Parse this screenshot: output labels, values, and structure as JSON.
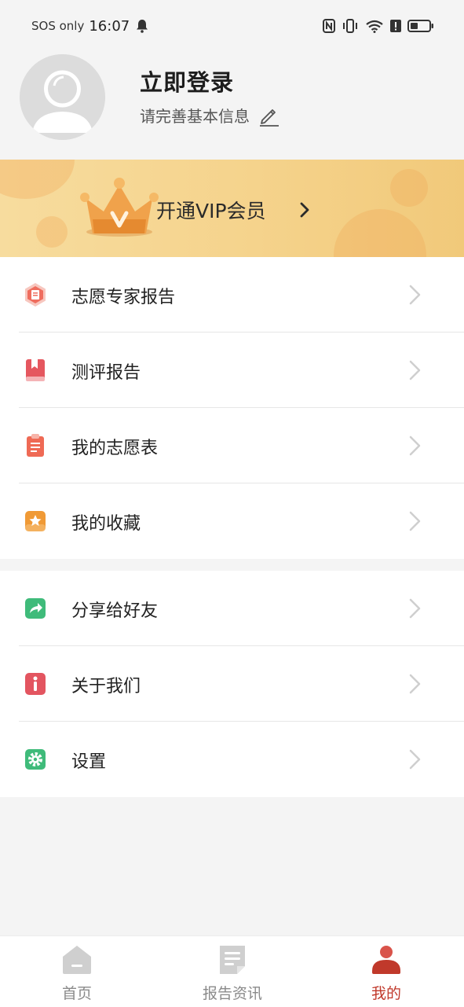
{
  "status_bar": {
    "carrier": "SOS only",
    "time": "16:07",
    "icons": [
      "bell-icon",
      "nfc-icon",
      "vibrate-icon",
      "wifi-icon",
      "alert-icon",
      "battery-icon"
    ]
  },
  "profile": {
    "title": "立即登录",
    "subtitle": "请完善基本信息"
  },
  "vip": {
    "label": "开通VIP会员"
  },
  "menu_group_1": [
    {
      "label": "志愿专家报告",
      "icon": "report-badge-icon",
      "color": "#ef6d5e"
    },
    {
      "label": "测评报告",
      "icon": "bookmark-book-icon",
      "color": "#e5575f"
    },
    {
      "label": "我的志愿表",
      "icon": "clipboard-icon",
      "color": "#ef6a55"
    },
    {
      "label": "我的收藏",
      "icon": "star-icon",
      "color": "#f09a36"
    }
  ],
  "menu_group_2": [
    {
      "label": "分享给好友",
      "icon": "share-arrow-icon",
      "color": "#3fbb7a"
    },
    {
      "label": "关于我们",
      "icon": "info-icon",
      "color": "#e35560"
    },
    {
      "label": "设置",
      "icon": "gear-icon",
      "color": "#3fbb7a"
    }
  ],
  "tabs": [
    {
      "label": "首页",
      "icon": "home-icon",
      "active": false
    },
    {
      "label": "报告资讯",
      "icon": "document-icon",
      "active": false
    },
    {
      "label": "我的",
      "icon": "person-icon",
      "active": true
    }
  ],
  "colors": {
    "accent": "#c0392b",
    "background": "#f4f4f4",
    "vip_gold": "#f5d38c"
  }
}
